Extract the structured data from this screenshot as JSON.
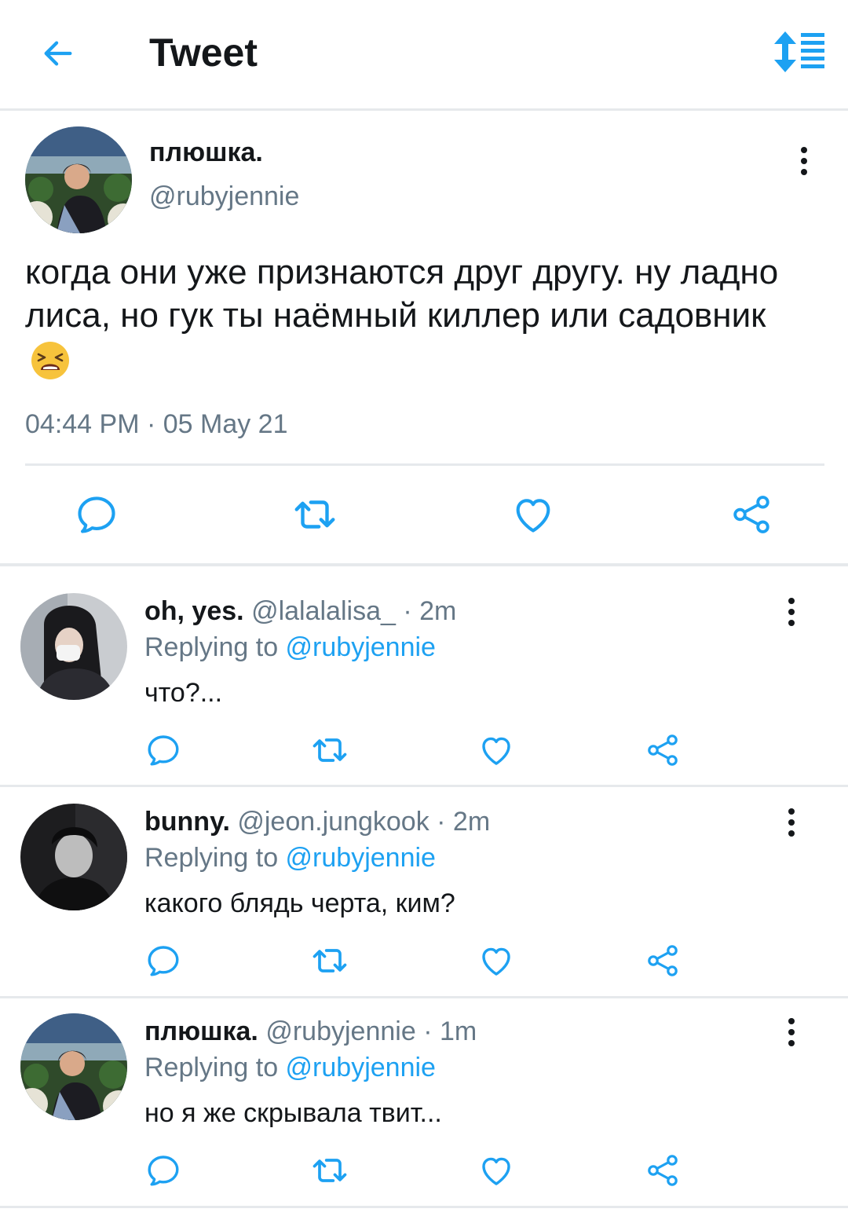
{
  "header": {
    "title": "Tweet"
  },
  "main_tweet": {
    "name": "плюшка.",
    "handle": "@rubyjennie",
    "text": "когда они уже признаются друг другу. ну ладно лиса, но гук ты наёмный киллер или садовник",
    "emoji": "tired-face-emoji",
    "timestamp": "04:44 PM · 05 May 21"
  },
  "replies": [
    {
      "name": "oh, yes.",
      "meta": "@lalalalisa_ · 2m",
      "replying_prefix": "Replying to ",
      "replying_to": "@rubyjennie",
      "text": "что?..."
    },
    {
      "name": "bunny.",
      "meta": "@jeon.jungkook · 2m",
      "replying_prefix": "Replying to ",
      "replying_to": "@rubyjennie",
      "text": "какого блядь черта, ким?"
    },
    {
      "name": "плюшка.",
      "meta": "@rubyjennie · 1m",
      "replying_prefix": "Replying to ",
      "replying_to": "@rubyjennie",
      "text": "но я же скрывала твит..."
    }
  ],
  "colors": {
    "accent": "#1da1f2",
    "text": "#14171a",
    "secondary": "#657786",
    "icon": "#1da1f2",
    "divider": "#e6e9ec"
  },
  "icons": [
    "back-arrow-icon",
    "sort-icon",
    "more-vertical-icon",
    "reply-icon",
    "retweet-icon",
    "like-icon",
    "share-icon"
  ]
}
